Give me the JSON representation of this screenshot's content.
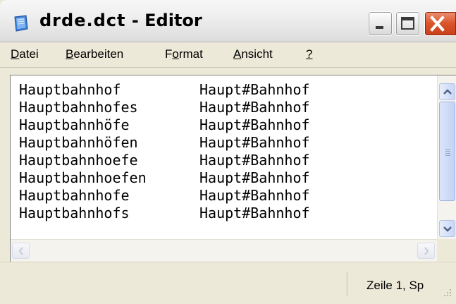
{
  "window": {
    "title_file": "drde.dct",
    "title_sep": " - ",
    "title_app": "Editor"
  },
  "menu": {
    "items": [
      {
        "label": "Datei",
        "accel_index": 0
      },
      {
        "label": "Bearbeiten",
        "accel_index": 0
      },
      {
        "label": "Format",
        "accel_index": 1
      },
      {
        "label": "Ansicht",
        "accel_index": 0
      },
      {
        "label": "?",
        "accel_index": 0
      }
    ]
  },
  "editor": {
    "lines": [
      {
        "word": "Hauptbahnhof",
        "split": "Haupt#Bahnhof"
      },
      {
        "word": "Hauptbahnhofes",
        "split": "Haupt#Bahnhof"
      },
      {
        "word": "Hauptbahnhöfe",
        "split": "Haupt#Bahnhof"
      },
      {
        "word": "Hauptbahnhöfen",
        "split": "Haupt#Bahnhof"
      },
      {
        "word": "Hauptbahnhoefe",
        "split": "Haupt#Bahnhof"
      },
      {
        "word": "Hauptbahnhoefen",
        "split": "Haupt#Bahnhof"
      },
      {
        "word": "Hauptbahnhofe",
        "split": "Haupt#Bahnhof"
      },
      {
        "word": "Hauptbahnhofs",
        "split": "Haupt#Bahnhof"
      }
    ]
  },
  "statusbar": {
    "position": "Zeile 1, Sp"
  },
  "icons": {
    "app": "notepad-icon",
    "minimize": "minimize-icon",
    "maximize": "maximize-icon",
    "close": "close-icon"
  },
  "colors": {
    "close_button": "#d9542a",
    "scrollbar_accent": "#c9d7f4",
    "window_face": "#ece9d8"
  }
}
